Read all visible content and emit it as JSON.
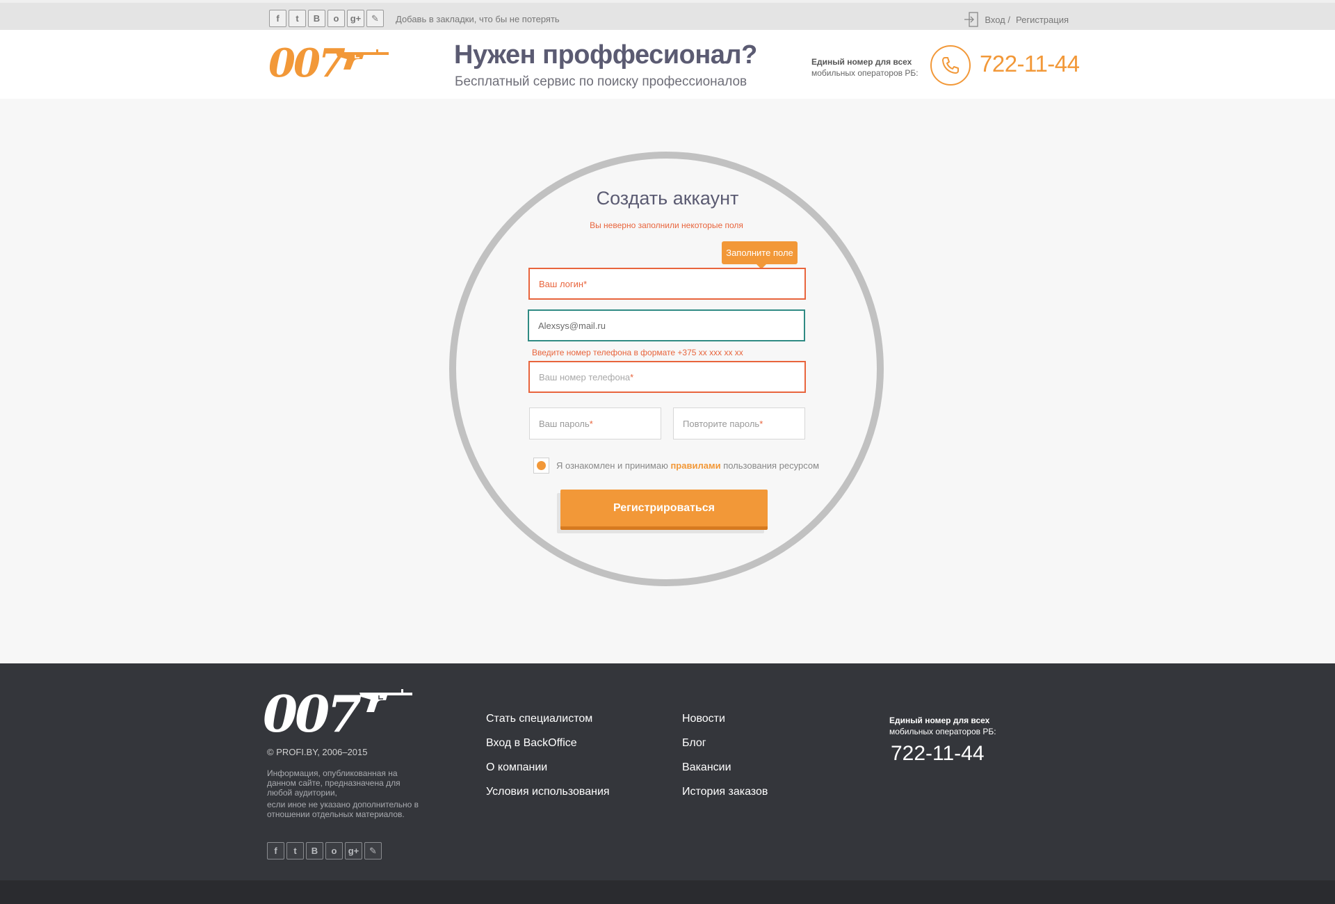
{
  "topbar": {
    "social": [
      {
        "icon": "facebook-icon",
        "glyph": "f"
      },
      {
        "icon": "twitter-icon",
        "glyph": "t"
      },
      {
        "icon": "vk-icon",
        "glyph": "B"
      },
      {
        "icon": "odnoklassniki-icon",
        "glyph": "o"
      },
      {
        "icon": "googleplus-icon",
        "glyph": "g+"
      },
      {
        "icon": "bookmark-icon",
        "glyph": "✎"
      }
    ],
    "bookmark_text": "Добавь в закладки, что бы не потерять",
    "login_label": "Вход /",
    "register_label": "Регистрация"
  },
  "header": {
    "logo_text": "007",
    "headline": "Нужен проффесионал?",
    "subline": "Бесплатный сервис по поиску профессионалов",
    "hotline_label_bold": "Единый номер для всех",
    "hotline_label_rest": "мобильных операторов РБ:",
    "phone": "722-11-44"
  },
  "form": {
    "title": "Создать аккаунт",
    "error_message": "Вы неверно заполнили некоторые поля",
    "tooltip": "Заполните поле",
    "login_placeholder": "Ваш логин",
    "email_value": "Alexsys@mail.ru",
    "phone_hint": "Введите номер телефона в формате +375 xx xxx xx xx",
    "phone_placeholder": "Ваш номер телефона",
    "password_placeholder": "Ваш пароль",
    "password_repeat_placeholder": "Повторите пароль",
    "required_mark": "*",
    "agree_text_before": "Я ознакомлен и принимаю",
    "agree_link": "правилами",
    "agree_text_after": "пользования ресурсом",
    "submit_label": "Регистрироваться"
  },
  "footer": {
    "logo_text": "007",
    "copyright": "© PROFI.BY, 2006–2015",
    "info_1": "Информация, опубликованная на данном сайте, предназначена для любой аудитории,",
    "info_2": "если иное не указано дополнительно в отношении отдельных материалов.",
    "col1": [
      "Стать специалистом",
      "Вход в BackOffice",
      "О компании",
      "Условия использования"
    ],
    "col2": [
      "Новости",
      "Блог",
      "Вакансии",
      "История заказов"
    ],
    "hotline_label_bold": "Единый номер для всех",
    "hotline_label_rest": "мобильных операторов РБ:",
    "phone": "722-11-44"
  },
  "colors": {
    "accent": "#f29838",
    "error": "#e8643c",
    "valid": "#2f8a83",
    "footer_bg": "#34363b"
  }
}
